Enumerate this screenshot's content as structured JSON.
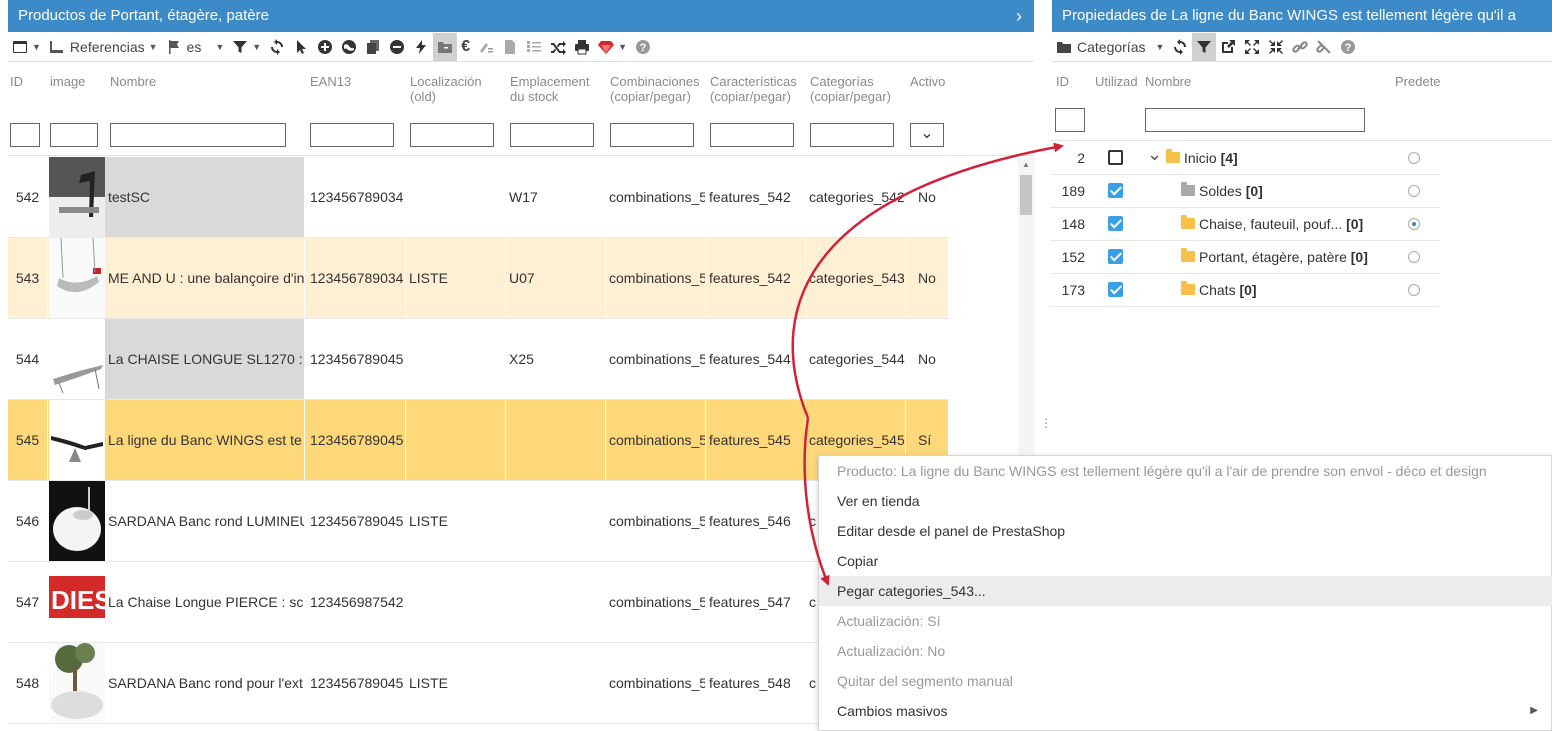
{
  "left_panel": {
    "title": "Productos de Portant, étagère, patère",
    "toolbar": {
      "referencias_label": "Referencias",
      "lang_label": "es"
    },
    "columns": [
      {
        "label_1": "ID",
        "label_2": ""
      },
      {
        "label_1": "image",
        "label_2": ""
      },
      {
        "label_1": "Nombre",
        "label_2": ""
      },
      {
        "label_1": "EAN13",
        "label_2": ""
      },
      {
        "label_1": "Localización",
        "label_2": "(old)"
      },
      {
        "label_1": "Emplacement",
        "label_2": "du stock"
      },
      {
        "label_1": "Combinaciones",
        "label_2": "(copiar/pegar)"
      },
      {
        "label_1": "Características",
        "label_2": "(copiar/pegar)"
      },
      {
        "label_1": "Categorías",
        "label_2": "(copiar/pegar)"
      },
      {
        "label_1": "Activo",
        "label_2": ""
      }
    ],
    "rows": [
      {
        "id": "542",
        "name": "testSC",
        "ean": "123456789034",
        "loc": "",
        "stock": "W17",
        "comb": "combinations_5",
        "feat": "features_542",
        "cat": "categories_542",
        "active": "No"
      },
      {
        "id": "543",
        "name": "ME AND U : une balançoire d'in",
        "ean": "123456789034",
        "loc": "LISTE",
        "stock": "U07",
        "comb": "combinations_5",
        "feat": "features_542",
        "cat": "categories_543",
        "active": "No"
      },
      {
        "id": "544",
        "name": "La CHAISE LONGUE SL1270 :",
        "ean": "123456789045",
        "loc": "",
        "stock": "X25",
        "comb": "combinations_5",
        "feat": "features_544",
        "cat": "categories_544",
        "active": "No"
      },
      {
        "id": "545",
        "name": "La ligne du Banc WINGS est te",
        "ean": "123456789045",
        "loc": "",
        "stock": "",
        "comb": "combinations_5",
        "feat": "features_545",
        "cat": "categories_545",
        "active": "Sí"
      },
      {
        "id": "546",
        "name": "SARDANA Banc rond LUMINEU",
        "ean": "123456789045",
        "loc": "LISTE",
        "stock": "",
        "comb": "combinations_5",
        "feat": "features_546",
        "cat": "c",
        "active": ""
      },
      {
        "id": "547",
        "name": "La Chaise Longue PIERCE : sc",
        "ean": "123456987542",
        "loc": "",
        "stock": "",
        "comb": "combinations_5",
        "feat": "features_547",
        "cat": "c",
        "active": ""
      },
      {
        "id": "548",
        "name": "SARDANA Banc rond pour l'ext",
        "ean": "123456789045",
        "loc": "LISTE",
        "stock": "",
        "comb": "combinations_5",
        "feat": "features_548",
        "cat": "c",
        "active": ""
      }
    ],
    "thumb_text_547": "DIESI"
  },
  "right_panel": {
    "title": "Propiedades de La ligne du Banc WINGS est tellement légère qu'il a",
    "toolbar": {
      "categorias_label": "Categorías"
    },
    "columns": {
      "id": "ID",
      "used": "Utilizad",
      "name": "Nombre",
      "default": "Predete"
    },
    "tree": [
      {
        "id": "2",
        "label": "Inicio",
        "count": "[4]",
        "checked": false,
        "default": false
      },
      {
        "id": "189",
        "label": "Soldes",
        "count": "[0]",
        "checked": true,
        "default": false
      },
      {
        "id": "148",
        "label": "Chaise, fauteuil, pouf...",
        "count": "[0]",
        "checked": true,
        "default": true
      },
      {
        "id": "152",
        "label": "Portant, étagère, patère",
        "count": "[0]",
        "checked": true,
        "default": false
      },
      {
        "id": "173",
        "label": "Chats",
        "count": "[0]",
        "checked": true,
        "default": false
      }
    ]
  },
  "context_menu": {
    "items": [
      {
        "label": "Producto: La ligne du Banc WINGS est tellement légère qu'il a l'air de prendre son envol - déco et design",
        "disabled": true
      },
      {
        "label": "Ver en tienda",
        "disabled": false
      },
      {
        "label": "Editar desde el panel de PrestaShop",
        "disabled": false
      },
      {
        "label": "Copiar",
        "disabled": false
      },
      {
        "label": "Pegar categories_543...",
        "disabled": false,
        "highlighted": true
      },
      {
        "label": "Actualización: Sí",
        "disabled": true
      },
      {
        "label": "Actualización: No",
        "disabled": true
      },
      {
        "label": "Quitar del segmento manual",
        "disabled": true
      },
      {
        "label": "Cambios masivos",
        "disabled": false,
        "submenu": true
      }
    ]
  },
  "colors": {
    "header_blue": "#3d8ac8",
    "selected_row": "#ffd87a",
    "alt_row": "#fff0d4",
    "checkbox_blue": "#3aa0e6",
    "folder_yellow": "#f7c04a",
    "folder_grey": "#a9a9a9",
    "arrow_red": "#d0233a"
  }
}
